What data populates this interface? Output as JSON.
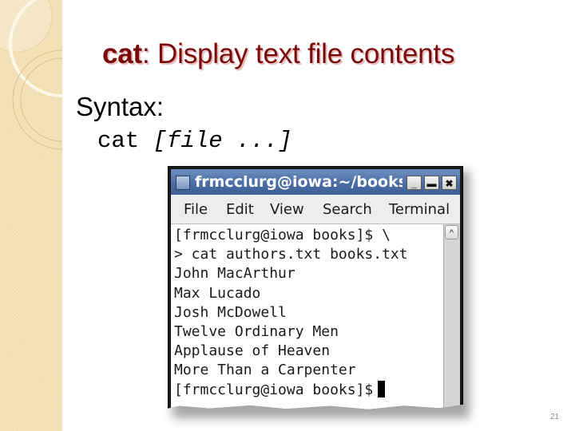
{
  "slide": {
    "title_command": "cat",
    "title_rest": ": Display text file contents",
    "syntax_label": "Syntax:",
    "syntax_command": "cat ",
    "syntax_args": "[file ...]",
    "slide_number": "21",
    "colors": {
      "title": "#7a0a0a",
      "sidebar": "#f3e0b4"
    }
  },
  "terminal_window": {
    "title": "frmcclurg@iowa:~/books",
    "icon": "terminal-window-icon",
    "buttons": {
      "minimize": "_",
      "maximize": "▬",
      "close": "✖"
    },
    "menu": [
      "File",
      "Edit",
      "View",
      "Search",
      "Terminal"
    ],
    "lines": [
      "[frmcclurg@iowa books]$ \\",
      "> cat authors.txt books.txt",
      "John MacArthur",
      "Max Lucado",
      "Josh McDowell",
      "Twelve Ordinary Men",
      "Applause of Heaven",
      "More Than a Carpenter"
    ],
    "prompt": "[frmcclurg@iowa books]$",
    "scroll_up_icon": "^",
    "colors": {
      "titlebar": "#4c6ea6"
    }
  }
}
